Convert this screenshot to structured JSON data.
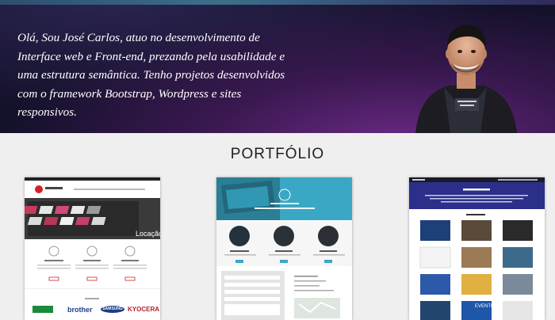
{
  "hero": {
    "intro": "Olá, Sou José Carlos, atuo no desenvolvimento de Interface web e Front-end, prezando pela usabilidade e uma estrutura semântica. Tenho projetos desenvolvidos com o framework Bootstrap, Wordpress e sites responsivos."
  },
  "portfolio": {
    "title": "PORTFÓLIO",
    "items": [
      {
        "location_label": "Locação",
        "service_labels": [
          "Equipamentos",
          "Locação",
          "Cotação"
        ],
        "logos": [
          "brother",
          "SAMSUNG",
          "KYOCERA"
        ]
      },
      {
        "service_labels": [
          "Notebooks e PCs",
          "Projetores",
          "Servidores"
        ]
      },
      {
        "section_label": "PORTFÓLIO",
        "tile_label": "EVENTOS"
      }
    ]
  },
  "colors": {
    "hero_bg": "#14112a",
    "hero_glow": "#6b2a86",
    "page_bg": "#efefef",
    "card2_accent": "#3aa8c4",
    "card3_header": "#2b2f8a"
  },
  "icons": [
    "profile-photo",
    "printer-photo",
    "laptop-photo"
  ]
}
